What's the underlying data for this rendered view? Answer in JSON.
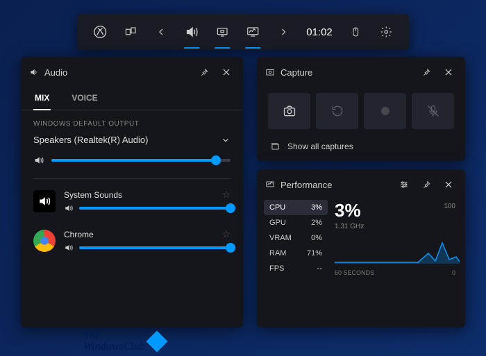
{
  "toolbar": {
    "time": "01:02"
  },
  "audio": {
    "title": "Audio",
    "tabs": {
      "mix": "MIX",
      "voice": "VOICE"
    },
    "section_label": "WINDOWS DEFAULT OUTPUT",
    "device": "Speakers (Realtek(R) Audio)",
    "master_volume": 92,
    "apps": [
      {
        "name": "System Sounds",
        "volume": 100,
        "icon": "system"
      },
      {
        "name": "Chrome",
        "volume": 100,
        "icon": "chrome"
      }
    ]
  },
  "capture": {
    "title": "Capture",
    "show_all": "Show all captures"
  },
  "performance": {
    "title": "Performance",
    "metrics": [
      {
        "label": "CPU",
        "value": "3%"
      },
      {
        "label": "GPU",
        "value": "2%"
      },
      {
        "label": "VRAM",
        "value": "0%"
      },
      {
        "label": "RAM",
        "value": "71%"
      },
      {
        "label": "FPS",
        "value": "--"
      }
    ],
    "selected_big": "3%",
    "selected_sub": "1.31 GHz",
    "y_max": "100",
    "y_min": "0",
    "x_label": "60 SECONDS"
  },
  "watermark": {
    "line1": "The",
    "line2": "WindowsClub"
  }
}
